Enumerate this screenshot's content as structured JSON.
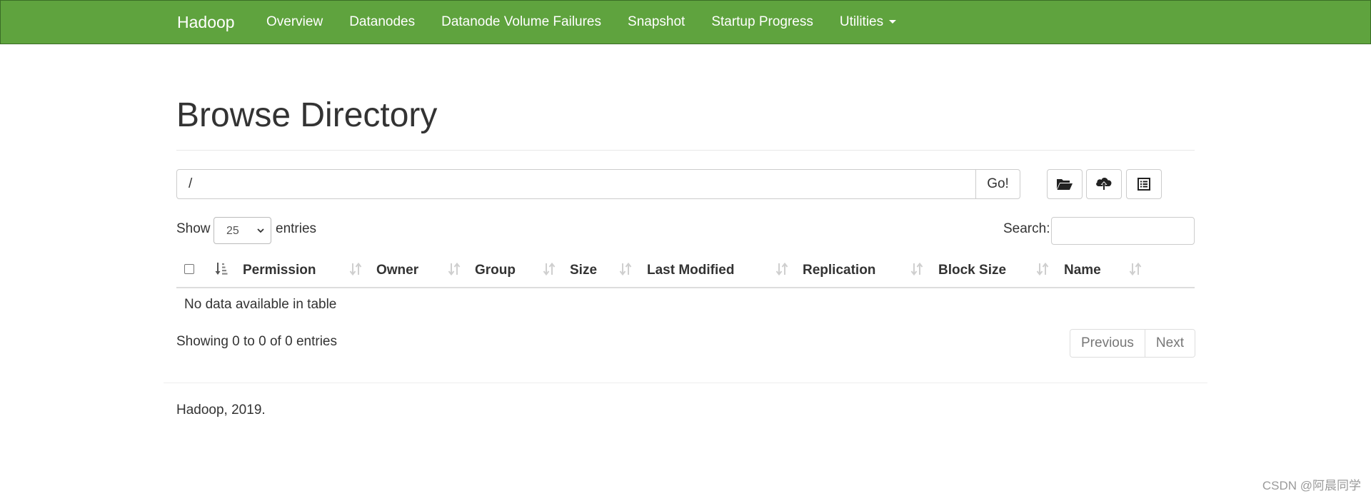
{
  "navbar": {
    "brand": "Hadoop",
    "items": [
      {
        "label": "Overview"
      },
      {
        "label": "Datanodes"
      },
      {
        "label": "Datanode Volume Failures"
      },
      {
        "label": "Snapshot"
      },
      {
        "label": "Startup Progress"
      },
      {
        "label": "Utilities"
      }
    ],
    "color": "#5fa33e"
  },
  "page": {
    "title": "Browse Directory"
  },
  "path_bar": {
    "value": "/",
    "go_label": "Go!",
    "actions": [
      {
        "icon": "folder-open-icon"
      },
      {
        "icon": "cloud-upload-icon"
      },
      {
        "icon": "list-alt-icon"
      }
    ]
  },
  "table_controls": {
    "show_label": "Show",
    "page_length": "25",
    "entries_label": "entries",
    "search_label": "Search:",
    "search_value": ""
  },
  "table": {
    "columns": [
      {
        "label": "Permission"
      },
      {
        "label": "Owner"
      },
      {
        "label": "Group"
      },
      {
        "label": "Size"
      },
      {
        "label": "Last Modified"
      },
      {
        "label": "Replication"
      },
      {
        "label": "Block Size"
      },
      {
        "label": "Name"
      }
    ],
    "empty_message": "No data available in table",
    "info": "Showing 0 to 0 of 0 entries"
  },
  "pagination": {
    "previous": "Previous",
    "next": "Next"
  },
  "footer": {
    "text": "Hadoop, 2019."
  },
  "watermark": "CSDN @阿晨同学"
}
